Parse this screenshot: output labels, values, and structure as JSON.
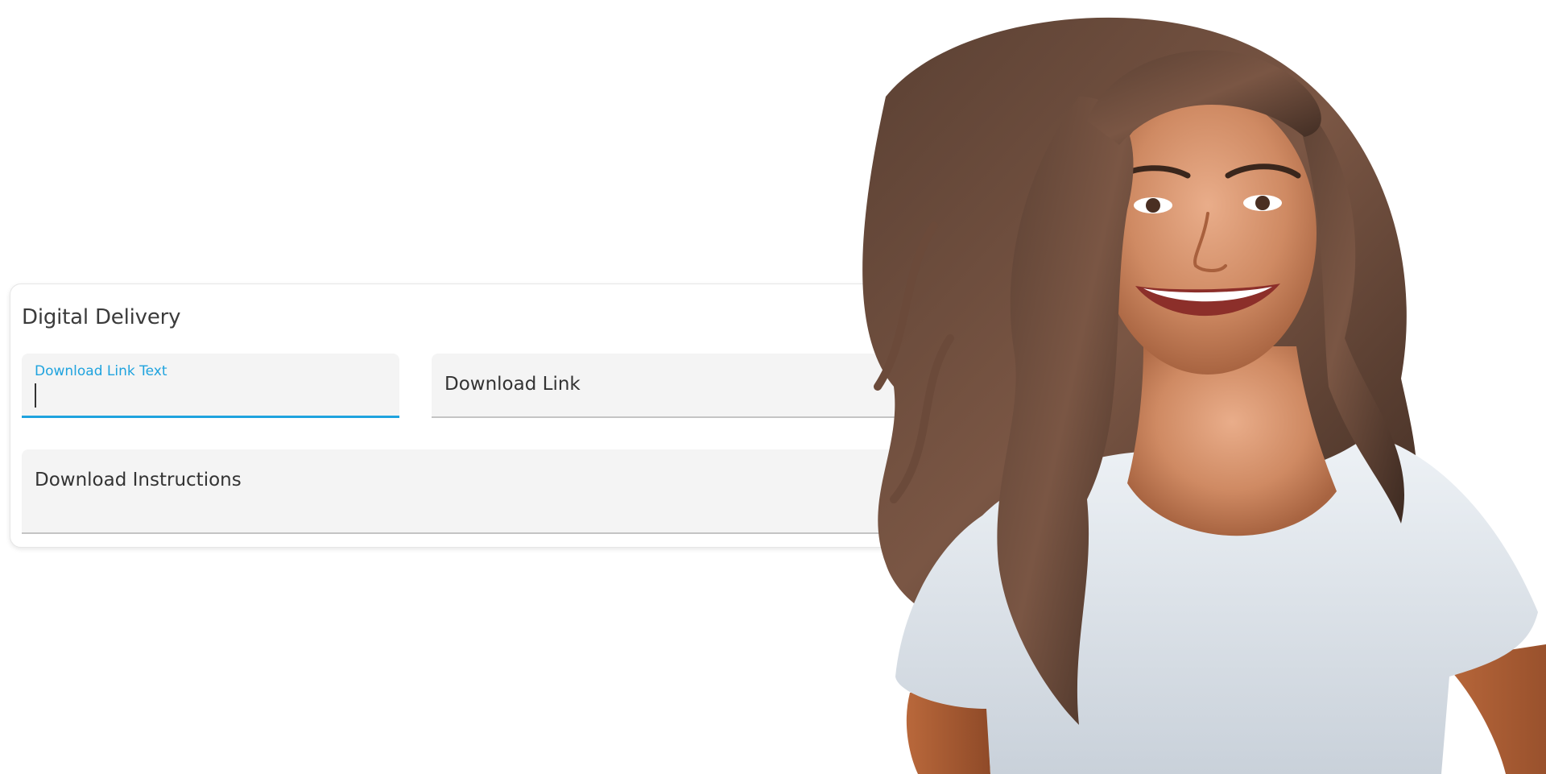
{
  "section": {
    "title": "Digital Delivery"
  },
  "fields": {
    "download_link_text": {
      "label": "Download Link Text",
      "value": ""
    },
    "download_link": {
      "label": "Download Link"
    },
    "download_instructions": {
      "label": "Download Instructions"
    }
  },
  "colors": {
    "accent": "#1fa3de",
    "field_background": "#f4f4f4",
    "text": "#333333"
  },
  "image": {
    "subject": "smiling-woman-photo"
  }
}
